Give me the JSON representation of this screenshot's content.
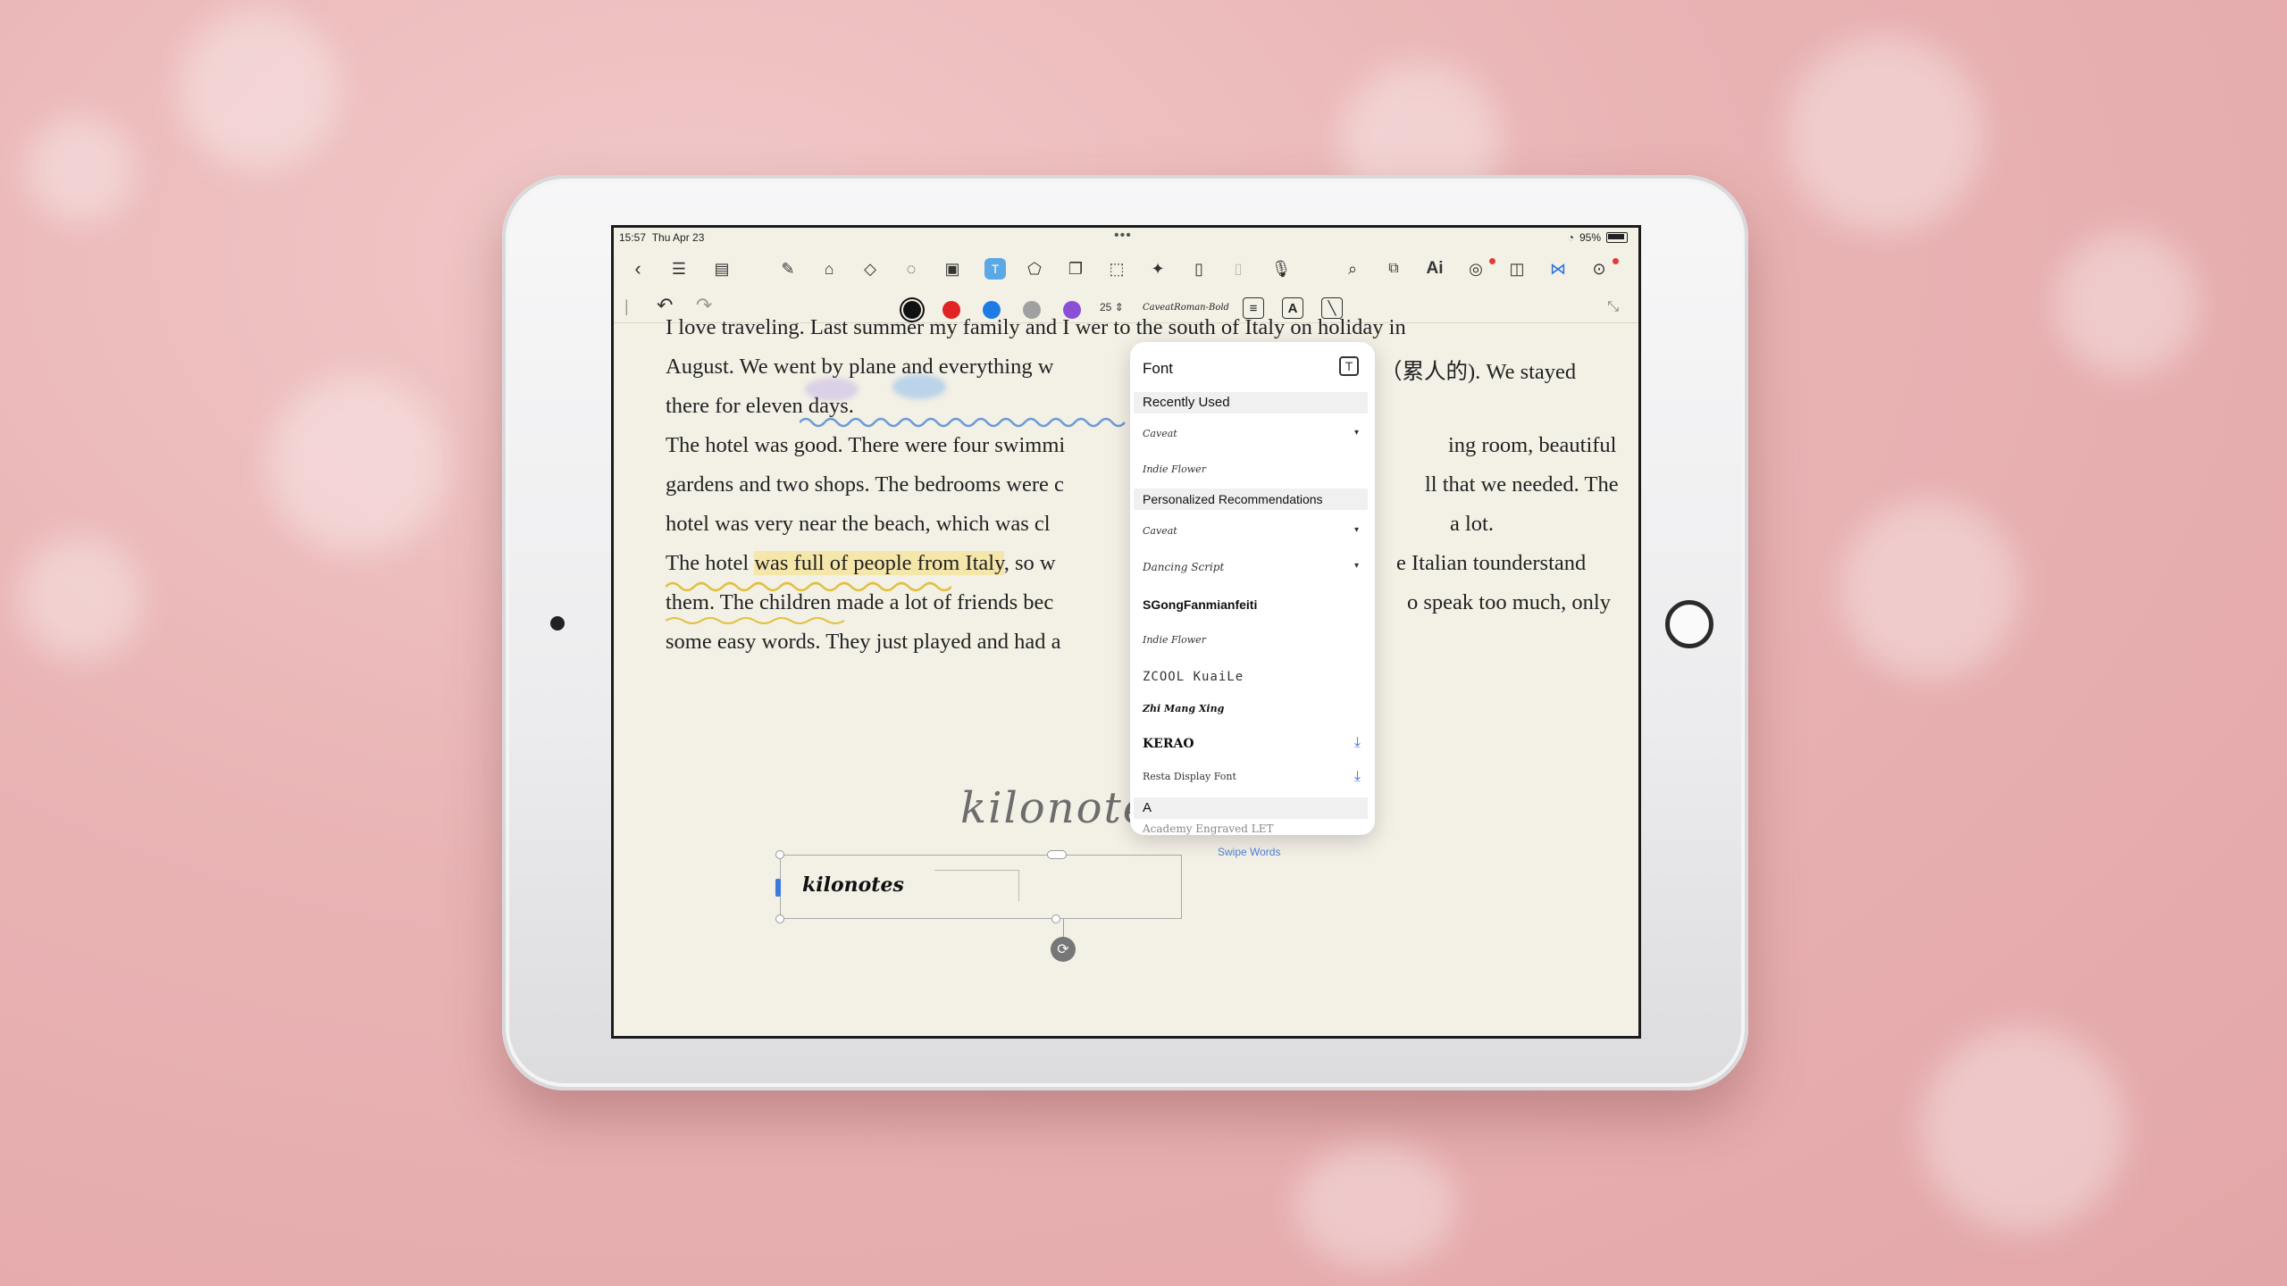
{
  "status": {
    "time": "15:57",
    "date": "Thu Apr 23",
    "battery": "95%"
  },
  "toolbar": {
    "icons": [
      "back-icon",
      "outline-icon",
      "page-list-icon",
      "pen-icon",
      "highlighter-icon",
      "eraser-icon",
      "lasso-icon",
      "image-icon",
      "text-tool-icon",
      "shape-icon",
      "sticker-icon",
      "select-area-icon",
      "ruler-icon",
      "notebook-icon",
      "scroll-icon",
      "mic-icon",
      "search-icon",
      "present-icon",
      "ai-icon",
      "palette-icon",
      "comments-icon",
      "share-icon",
      "more-icon"
    ],
    "ai_label": "Ai"
  },
  "subbar": {
    "font_size": "25",
    "font_name": "CaveatRoman-Bold",
    "bold_label": "A",
    "colors": [
      "#111111",
      "#e02424",
      "#1e7be6",
      "#a0a0a0",
      "#8a4fd6"
    ]
  },
  "document": {
    "lines": [
      "I love traveling. Last summer my family and I wer  to the south of Italy on holiday in",
      "August. We went by plane and everything w",
      "there for eleven days.",
      "The hotel was good. There were four swimmi",
      "gardens and two shops. The bedrooms were c",
      "hotel was very near the beach, which was cl",
      "The hotel",
      "was full of people from Italy",
      ", so w",
      "them. The children made a lot of friends bec",
      "some easy words. They just played and had a"
    ],
    "right_lines": [
      "（累人的). We stayed",
      "ing room, beautiful",
      "ll that we needed. The",
      "a lot.",
      "e Italian tounderstand",
      "o speak too much, only"
    ],
    "signature": "kilonotes",
    "textbox_text": "kilonotes"
  },
  "font_panel": {
    "title": "Font",
    "recent_header": "Recently Used",
    "recent": [
      "Caveat",
      "Indie Flower"
    ],
    "recommend_header": "Personalized Recommendations",
    "recommended": [
      "Caveat",
      "Dancing Script",
      "SGongFanmianfeiti",
      "Indie Flower",
      "ZCOOL KuaiLe",
      "Zhi Mang Xing",
      "KERAO",
      "Resta Display Font"
    ],
    "alpha_header": "A",
    "alpha_first": "Academy Engraved LET"
  },
  "swipe_words": "Swipe Words"
}
